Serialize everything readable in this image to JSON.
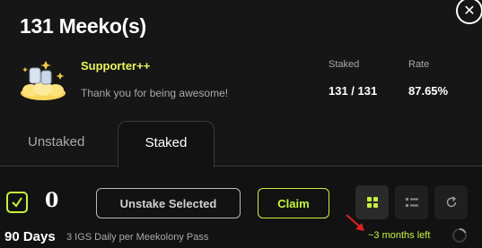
{
  "modal": {
    "title": "131 Meeko(s)",
    "close_symbol": "✕"
  },
  "membership": {
    "tier": "Supporter++",
    "message": "Thank you for being awesome!",
    "badge_icon": "supporter-badge-icon"
  },
  "stats": {
    "staked_label": "Staked",
    "staked_value": "131 / 131",
    "rate_label": "Rate",
    "rate_value": "87.65%"
  },
  "tabs": [
    {
      "label": "Unstaked",
      "active": false
    },
    {
      "label": "Staked",
      "active": true
    }
  ],
  "toolbar": {
    "select_all_checked": true,
    "selected_count": "0",
    "unstake_label": "Unstake Selected",
    "claim_label": "Claim",
    "view_modes": [
      "grid-view-icon",
      "list-view-icon"
    ],
    "active_view": "grid-view-icon",
    "refresh_icon": "refresh-icon"
  },
  "item": {
    "days": "90 Days",
    "daily_reward": "3 IGS Daily per Meekolony Pass",
    "time_left": "~3 months left"
  },
  "colors": {
    "accent": "#c7f23f",
    "tier_color": "#e8f55c",
    "background": "#121212",
    "annotation_arrow": "#e02020"
  }
}
